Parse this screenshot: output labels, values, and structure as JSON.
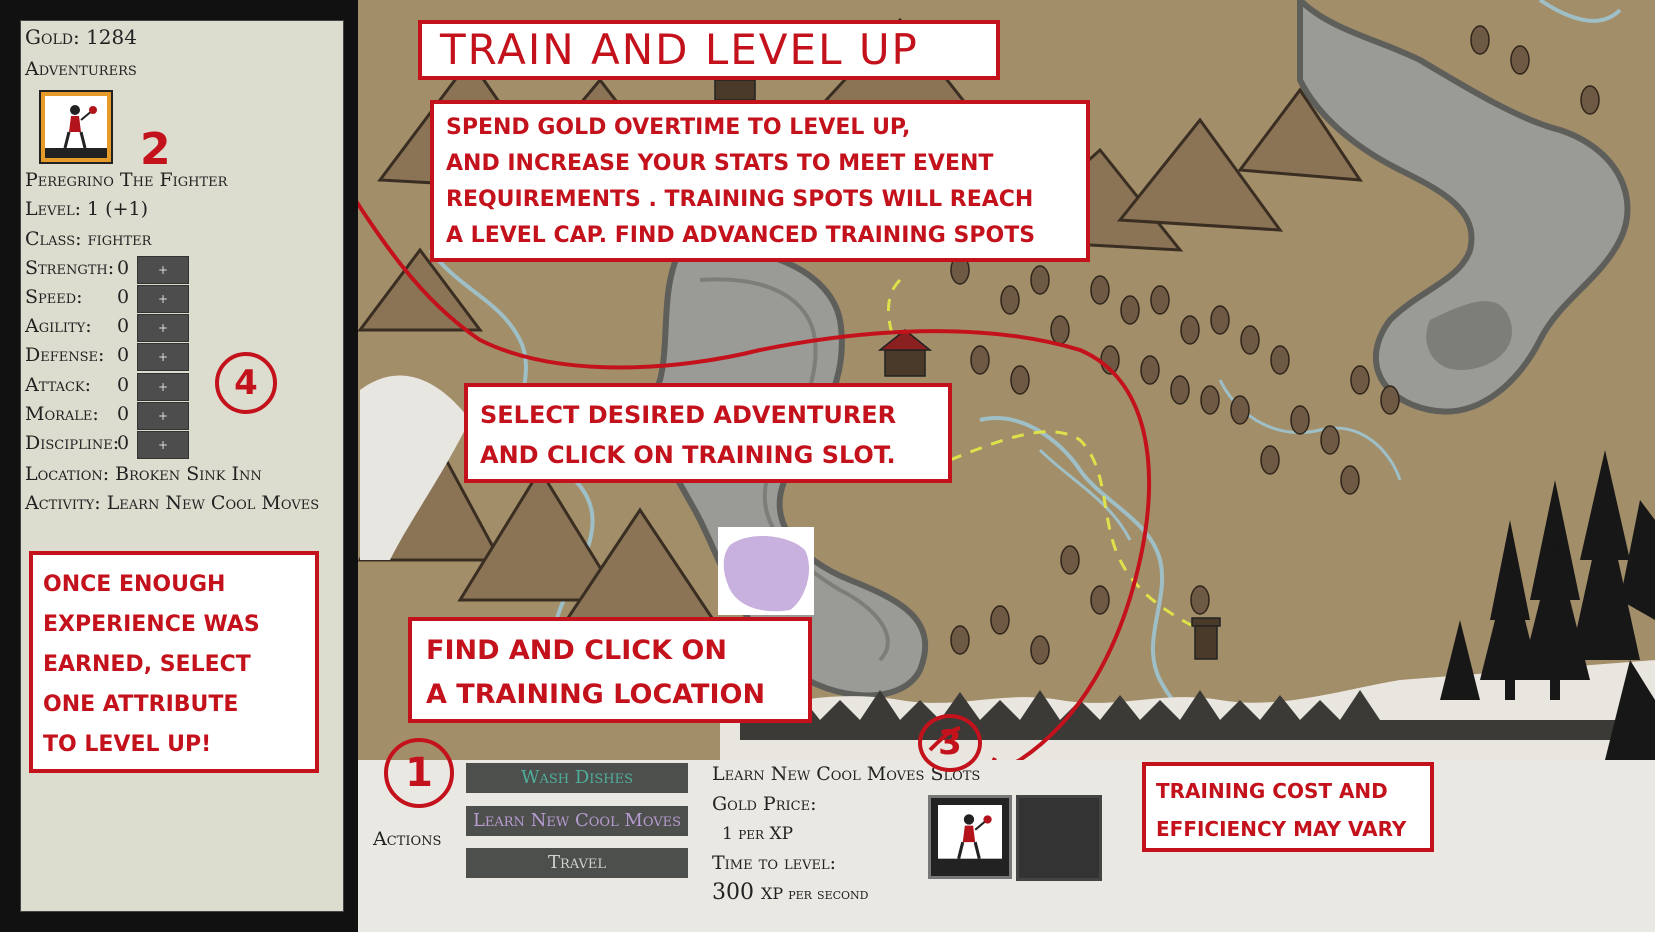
{
  "colors": {
    "annotation_red": "#c4121c",
    "panel_bg": "#dcdccf",
    "map_bg": "#a38e6a",
    "button_dark": "#4d4f4c",
    "button_teal_text": "#4fae9b",
    "button_purple_text": "#b79bd1"
  },
  "player": {
    "gold_label": "Gold: 1284",
    "adventurers_heading": "Adventurers"
  },
  "adventurer": {
    "name": "Peregrino The Fighter",
    "level": "Level: 1 (+1)",
    "class": "Class: fighter",
    "location": "Location: Broken Sink Inn",
    "activity": "Activity: Learn New Cool Moves",
    "stats": [
      {
        "label": "Strength:",
        "value": "0"
      },
      {
        "label": "Speed:",
        "value": "0"
      },
      {
        "label": "Agility:",
        "value": "0"
      },
      {
        "label": "Defense:",
        "value": "0"
      },
      {
        "label": "Attack:",
        "value": "0"
      },
      {
        "label": "Morale:",
        "value": "0"
      },
      {
        "label": "Discipline:",
        "value": "0"
      }
    ],
    "plus_label": "+"
  },
  "annotations": {
    "title": "Train and level up",
    "spend_lines": [
      "Spend gold overtime to level up,",
      "and increase your stats to meet event",
      "requirements . Training spots will reach",
      "a level cap. Find advanced training spots"
    ],
    "select_lines": [
      "Select desired adventurer",
      "and click on training slot."
    ],
    "find_lines": [
      "Find and click on",
      "a training location"
    ],
    "once_lines": [
      "Once enough",
      "experience was",
      "earned, select",
      "one attribute",
      "to level up!"
    ],
    "cost_lines": [
      "Training cost and",
      "efficiency may vary"
    ],
    "step1": "1",
    "step2": "2",
    "step3": "3",
    "step4": "4"
  },
  "actions": {
    "label": "Actions",
    "buttons": [
      "Wash Dishes",
      "Learn New Cool Moves",
      "Travel"
    ]
  },
  "training": {
    "slots_title": "Learn New Cool Moves Slots",
    "gold_price_label": "Gold Price:",
    "gold_price_value": "1 per XP",
    "time_label": "Time to level:",
    "time_value_num": "300",
    "time_value_unit": "XP per second"
  }
}
